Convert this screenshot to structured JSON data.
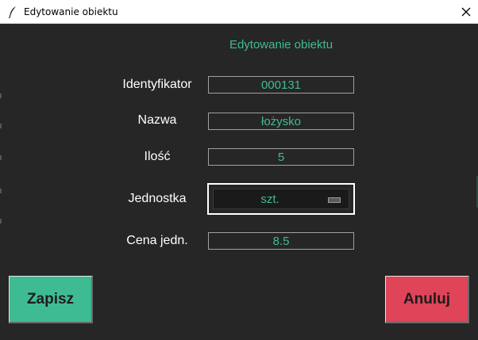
{
  "window": {
    "title": "Edytowanie obiektu"
  },
  "form": {
    "heading": "Edytowanie obiektu",
    "fields": [
      {
        "label": "Identyfikator",
        "value": "000131"
      },
      {
        "label": "Nazwa",
        "value": "łożysko"
      },
      {
        "label": "Ilość",
        "value": "5"
      },
      {
        "label": "Jednostka",
        "value": "szt."
      },
      {
        "label": "Cena jedn.",
        "value": "8.5"
      }
    ]
  },
  "buttons": {
    "save": "Zapisz",
    "cancel": "Anuluj"
  },
  "colors": {
    "accent": "#3fbb94",
    "danger": "#df4458",
    "background": "#262626"
  },
  "icons": {
    "app": "feather-icon",
    "close": "close-icon"
  }
}
